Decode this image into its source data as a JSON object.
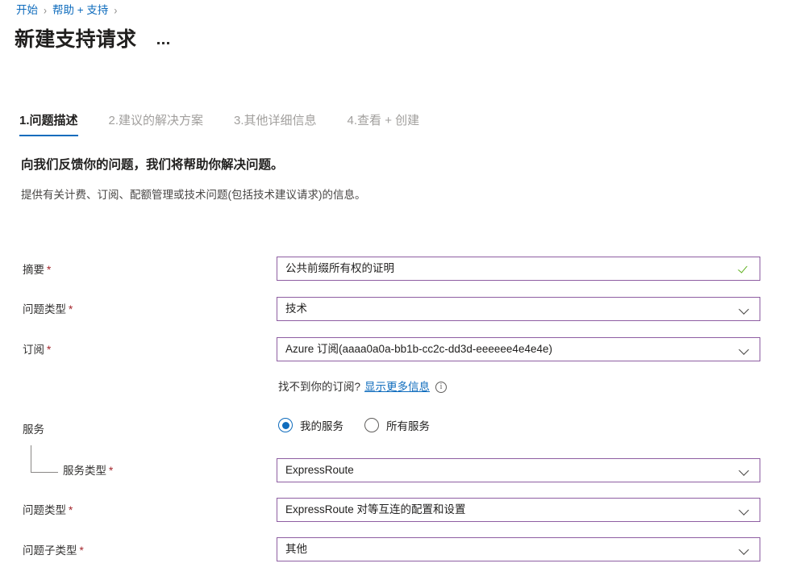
{
  "breadcrumb": {
    "items": [
      {
        "label": "开始",
        "link": true
      },
      {
        "label": "帮助 + 支持",
        "link": true
      }
    ],
    "separator": "›"
  },
  "header": {
    "title": "新建支持请求",
    "overflow_menu": "more-actions"
  },
  "tabs": [
    {
      "label": "1.问题描述",
      "active": true
    },
    {
      "label": "2.建议的解决方案",
      "active": false
    },
    {
      "label": "3.其他详细信息",
      "active": false
    },
    {
      "label": "4.查看 + 创建",
      "active": false
    }
  ],
  "intro": {
    "heading": "向我们反馈你的问题，我们将帮助你解决问题。",
    "subtext": "提供有关计费、订阅、配额管理或技术问题(包括技术建议请求)的信息。"
  },
  "form": {
    "summary": {
      "label": "摘要",
      "required": "*",
      "value": "公共前缀所有权的证明",
      "validated": true
    },
    "issue_type": {
      "label": "问题类型",
      "required": "*",
      "value": "技术"
    },
    "subscription": {
      "label": "订阅",
      "required": "*",
      "value": "Azure 订阅(aaaa0a0a-bb1b-cc2c-dd3d-eeeeee4e4e4e)"
    },
    "subscription_hint": {
      "text": "找不到你的订阅?",
      "link_text": "显示更多信息",
      "info_icon": "info-circle-icon"
    },
    "service": {
      "label": "服务",
      "options": [
        {
          "label": "我的服务",
          "selected": true
        },
        {
          "label": "所有服务",
          "selected": false
        }
      ]
    },
    "service_type": {
      "label": "服务类型",
      "required": "*",
      "value": "ExpressRoute"
    },
    "problem_type": {
      "label": "问题类型",
      "required": "*",
      "value": "ExpressRoute 对等互连的配置和设置"
    },
    "problem_subtype": {
      "label": "问题子类型",
      "required": "*",
      "value": "其他"
    }
  },
  "colors": {
    "link": "#0f6cbd",
    "accent": "#0f6cbd",
    "field_border": "#8e5ea2",
    "required_asterisk": "#a4262c",
    "valid_check": "#5fb01e",
    "tab_inactive": "#a19f9d"
  }
}
